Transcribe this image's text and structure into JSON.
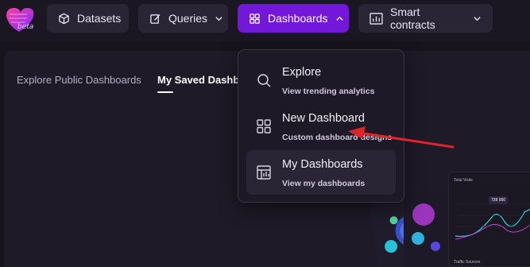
{
  "app": {
    "badge": "beta"
  },
  "nav": {
    "datasets": "Datasets",
    "queries": "Queries",
    "dashboards": "Dashboards",
    "smart_contracts": "Smart contracts"
  },
  "tabs": {
    "public": "Explore Public Dashboards",
    "saved": "My Saved Dashboards"
  },
  "dropdown": {
    "items": [
      {
        "title": "Explore",
        "subtitle": "View trending analytics",
        "icon": "search-icon"
      },
      {
        "title": "New Dashboard",
        "subtitle": "Custom dashboard designs",
        "icon": "grid-icon"
      },
      {
        "title": "My Dashboards",
        "subtitle": "View my dashboards",
        "icon": "dashboard-icon"
      }
    ]
  },
  "previews": {
    "total_visits": "Total Visits",
    "traffic_sources": "Traffic Sources",
    "value_badge": "728 000"
  },
  "colors": {
    "accent": "#7317d9",
    "annotation": "#e0242a",
    "background": "#17141e"
  }
}
